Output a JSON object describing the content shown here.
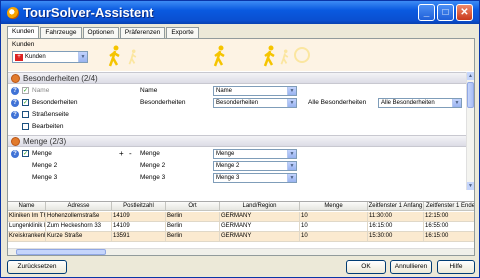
{
  "window": {
    "title": "TourSolver-Assistent"
  },
  "tabs": [
    "Kunden",
    "Fahrzeuge",
    "Optionen",
    "Präferenzen",
    "Exporte"
  ],
  "header": {
    "label": "Kunden",
    "select_value": "Kunden"
  },
  "sections": {
    "besonderheiten": {
      "title": "Besonderheiten (2/4)",
      "rows": [
        {
          "label": "Name",
          "field": "Name",
          "value": "Name"
        },
        {
          "label": "Besonderheiten",
          "field": "Besonderheiten",
          "value": "Besonderheiten",
          "all_label": "Alle Besonderheiten",
          "all_value": "Alle Besonderheiten"
        },
        {
          "label": "Straßenseite"
        },
        {
          "label": "Bearbeiten"
        }
      ]
    },
    "menge": {
      "title": "Menge (2/3)",
      "rows": [
        {
          "label": "Menge",
          "plus": "+",
          "minus": "-",
          "field": "Menge",
          "value": "Menge"
        },
        {
          "label": "Menge 2",
          "field": "Menge 2",
          "value": "Menge 2"
        },
        {
          "label": "Menge 3",
          "field": "Menge 3",
          "value": "Menge 3"
        }
      ]
    }
  },
  "table": {
    "columns": [
      "Name",
      "Adresse",
      "Postleitzahl",
      "Ort",
      "Land/Region",
      "Menge",
      "Zeitfenster 1 Anfang",
      "Zeitfenster 1 Ende",
      "Z"
    ],
    "rows": [
      [
        "Kliniken Im Theodor-",
        "Hohenzollernstraße",
        "14109",
        "Berlin",
        "GERMANY",
        "10",
        "11:30:00",
        "12:15:00",
        ""
      ],
      [
        "Lungenklinik Heckesh",
        "Zum Heckeshorn 33",
        "14109",
        "Berlin",
        "GERMANY",
        "10",
        "16:15:00",
        "16:55:00",
        ""
      ],
      [
        "Kreiskrankenhaus St",
        "Kurze Straße",
        "13591",
        "Berlin",
        "GERMANY",
        "10",
        "15:30:00",
        "16:15:00",
        ""
      ]
    ]
  },
  "buttons": {
    "reset": "Zurücksetzen",
    "ok": "OK",
    "cancel": "Annullieren",
    "help": "Hilfe"
  },
  "colors": {
    "title_bar": "#0a5ae0",
    "accent_orange": "#e27b2c",
    "figure_yellow": "#f5c400"
  }
}
